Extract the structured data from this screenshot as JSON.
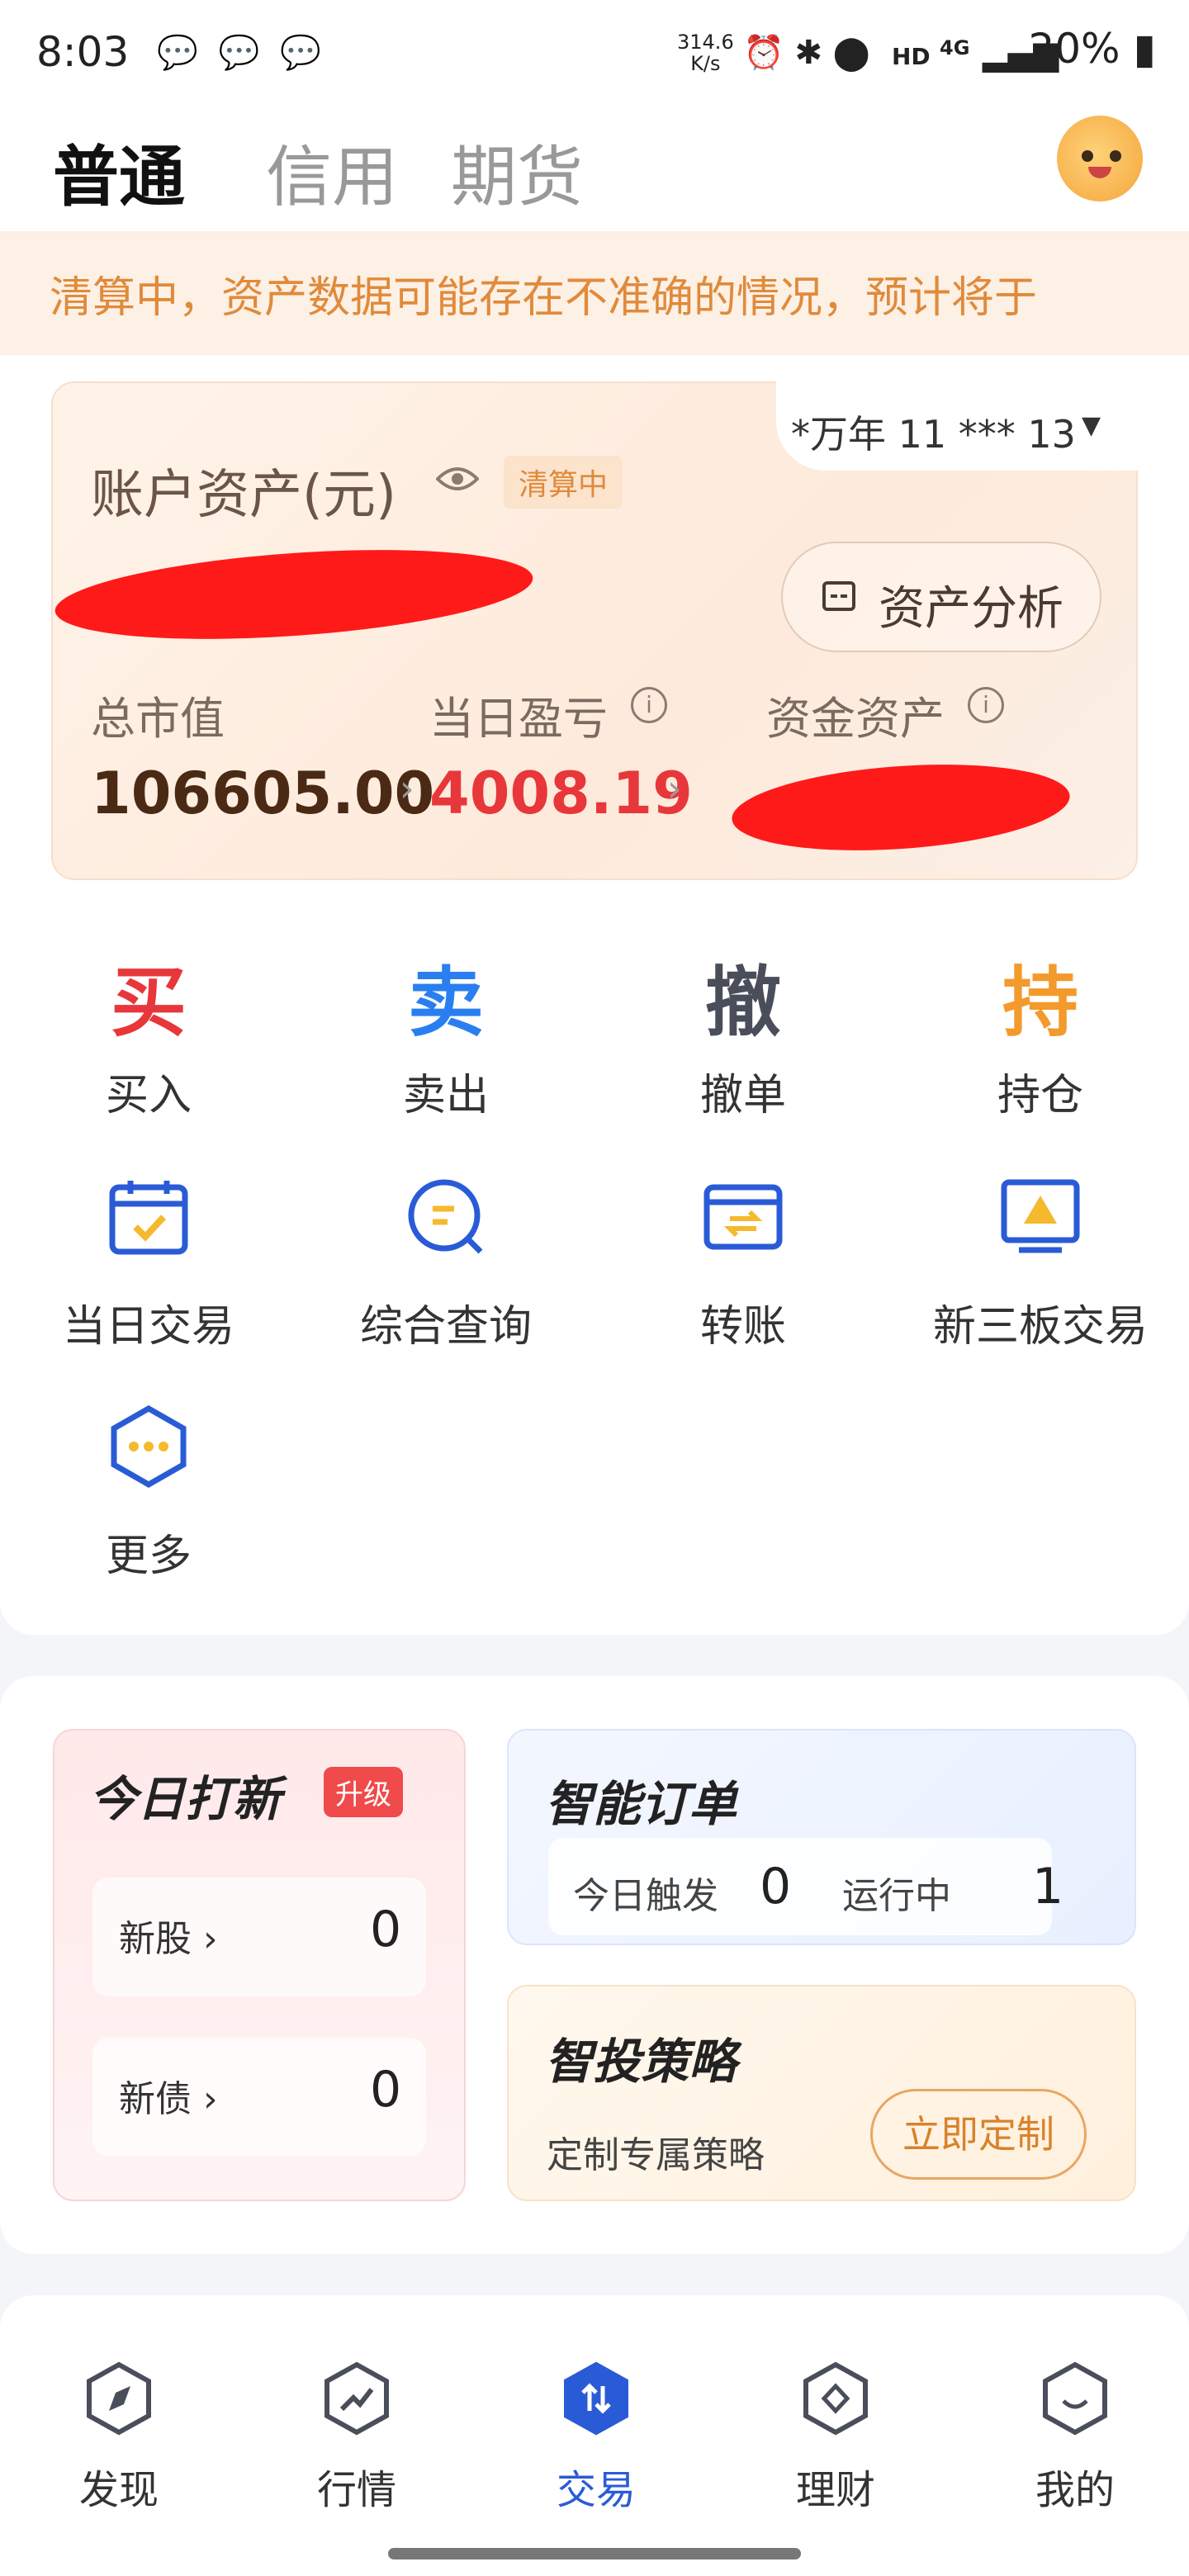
{
  "status_bar": {
    "time": "8:03",
    "speed_value": "314.6",
    "speed_unit": "K/s",
    "net": "HD",
    "net_type": "4G",
    "battery": "20%"
  },
  "header": {
    "tabs": [
      {
        "label": "普通",
        "active": true
      },
      {
        "label": "信用",
        "active": false
      },
      {
        "label": "期货",
        "active": false
      }
    ]
  },
  "notice": {
    "text": "清算中，资产数据可能存在不准确的情况，预计将于"
  },
  "asset_card": {
    "account_mask": "*万年 11 *** 13",
    "title": "账户资产(元)",
    "status_badge": "清算中",
    "analysis_button": "资产分析",
    "metrics": [
      {
        "label": "总市值",
        "value": "106605.00"
      },
      {
        "label": "当日盈亏",
        "value": "4008.19"
      },
      {
        "label": "资金资产",
        "value": ""
      }
    ]
  },
  "quick_actions": [
    {
      "glyph": "买",
      "label": "买入",
      "color": "#e8373a"
    },
    {
      "glyph": "卖",
      "label": "卖出",
      "color": "#2a7ff0"
    },
    {
      "glyph": "撤",
      "label": "撤单",
      "color": "#4a4e5a"
    },
    {
      "glyph": "持",
      "label": "持仓",
      "color": "#f39a2c"
    }
  ],
  "tools": [
    {
      "label": "当日交易",
      "icon": "calendar-check-icon"
    },
    {
      "label": "综合查询",
      "icon": "search-chat-icon"
    },
    {
      "label": "转账",
      "icon": "transfer-card-icon"
    },
    {
      "label": "新三板交易",
      "icon": "board-screen-icon"
    },
    {
      "label": "更多",
      "icon": "more-hexagon-icon"
    }
  ],
  "ipo": {
    "title": "今日打新",
    "badge": "升级",
    "rows": [
      {
        "label": "新股",
        "value": "0"
      },
      {
        "label": "新债",
        "value": "0"
      }
    ]
  },
  "smart_order": {
    "title": "智能订单",
    "triggered_label": "今日触发",
    "triggered_value": "0",
    "running_label": "运行中",
    "running_value": "1"
  },
  "strategy": {
    "title": "智投策略",
    "subtitle": "定制专属策略",
    "button": "立即定制"
  },
  "bottom_nav": [
    {
      "label": "发现",
      "active": false
    },
    {
      "label": "行情",
      "active": false
    },
    {
      "label": "交易",
      "active": true
    },
    {
      "label": "理财",
      "active": false
    },
    {
      "label": "我的",
      "active": false
    }
  ],
  "colors": {
    "accent": "#2a5bd7",
    "profit": "#e8373a",
    "value_dark": "#4a2a14",
    "notice_text": "#e08a3b"
  }
}
